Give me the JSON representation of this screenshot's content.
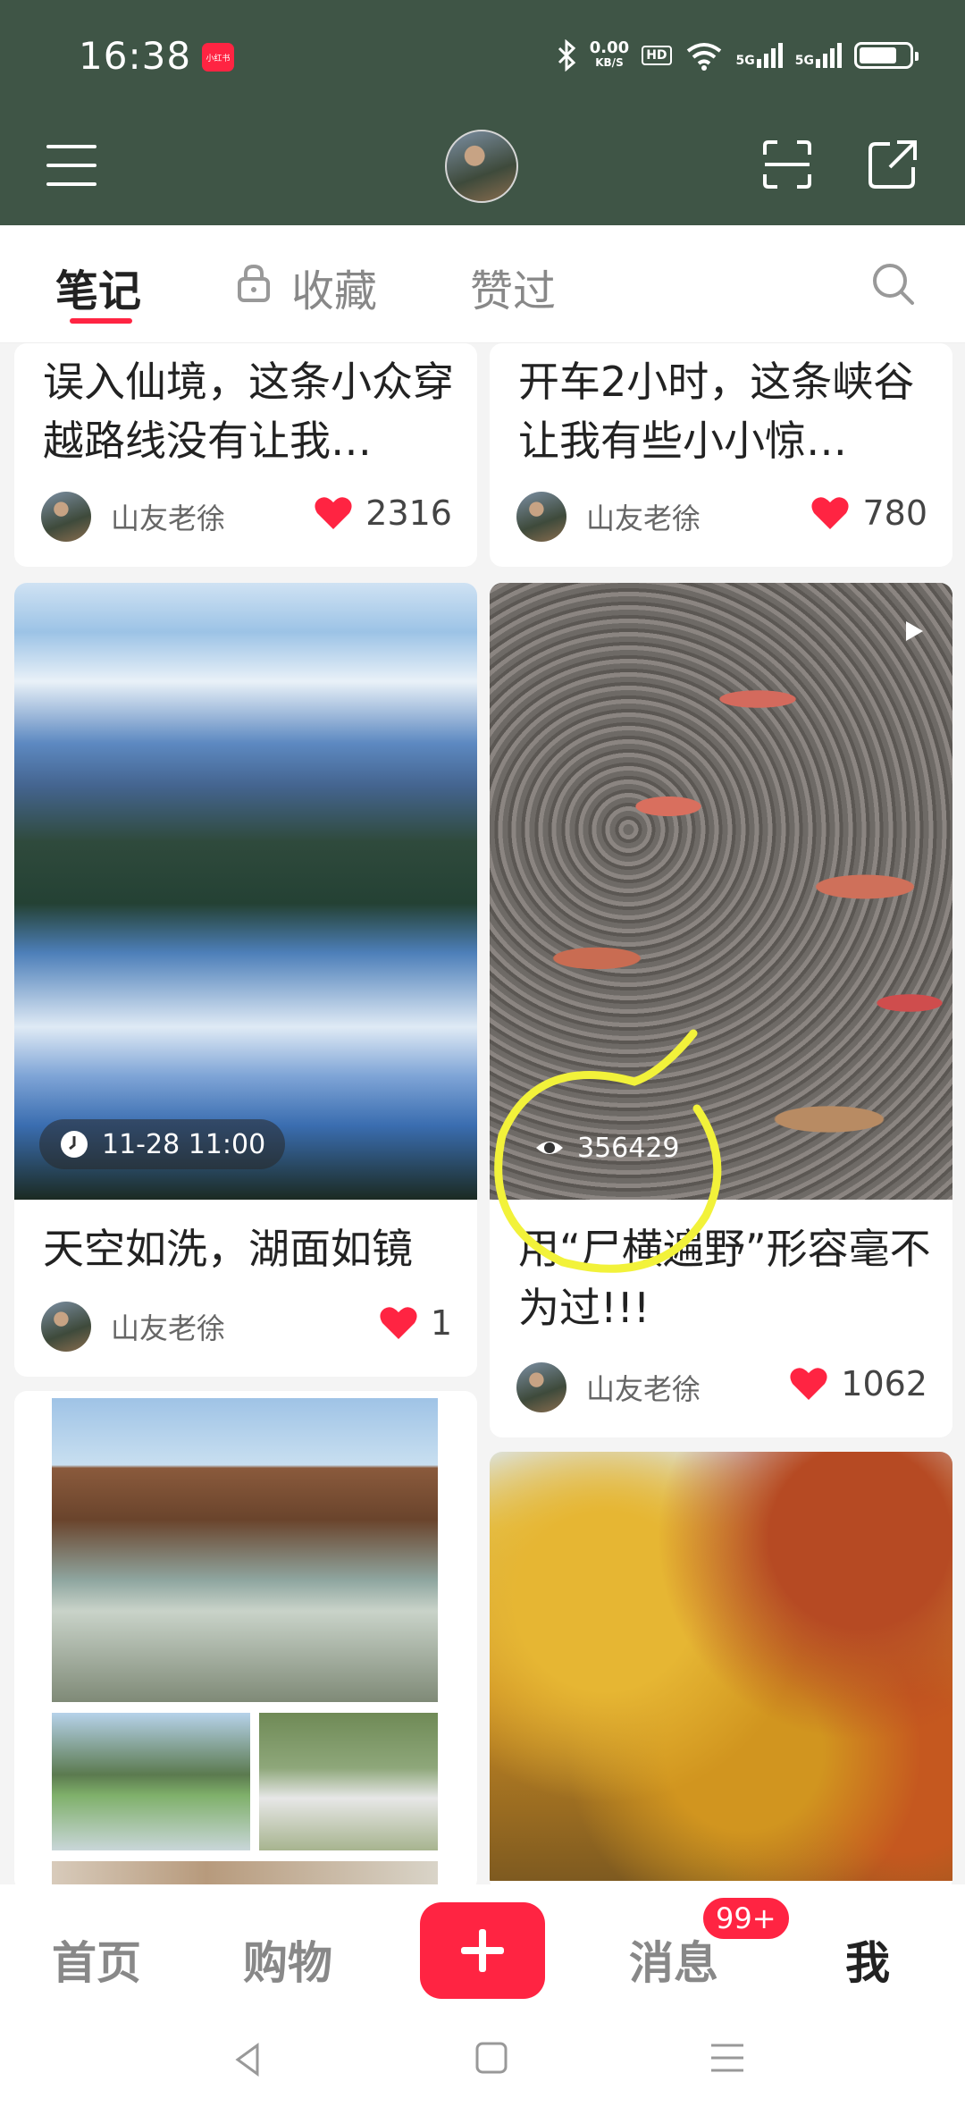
{
  "status_bar": {
    "time": "16:38",
    "app_badge": "小红书",
    "net_speed": "0.00",
    "net_unit": "KB/S",
    "hd": "HD",
    "signal1": "5G",
    "signal2": "5G",
    "battery_level": 0.75
  },
  "header": {
    "menu_icon": "hamburger-icon",
    "avatar": "profile-avatar",
    "scan_icon": "scan-icon",
    "share_icon": "share-icon"
  },
  "tabs": [
    {
      "label": "笔记",
      "active": true
    },
    {
      "label": "收藏",
      "locked": true
    },
    {
      "label": "赞过"
    }
  ],
  "feed": {
    "cards": [
      {
        "title": "误入仙境，这条小众穿越路线没有让我…",
        "author": "山友老徐",
        "likes": "2316"
      },
      {
        "title": "开车2小时，这条峡谷让我有些小小惊…",
        "author": "山友老徐",
        "likes": "780"
      },
      {
        "title": "天空如洗，湖面如镜",
        "author": "山友老徐",
        "likes": "1",
        "overlay": "11-28 11:00"
      },
      {
        "title": "用“尸横遍野”形容毫不为过!!!",
        "author": "山友老徐",
        "likes": "1062",
        "views": "356429"
      }
    ]
  },
  "bottom_nav": {
    "home": "首页",
    "shop": "购物",
    "messages": "消息",
    "messages_badge": "99+",
    "me": "我"
  },
  "colors": {
    "header_bg": "#3f5546",
    "accent": "#ff2442"
  }
}
